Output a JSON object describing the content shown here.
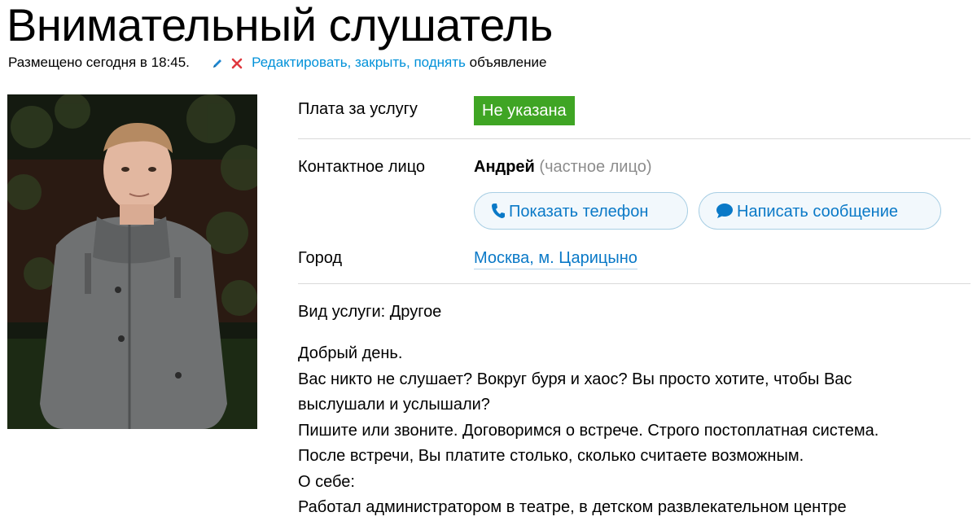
{
  "title": "Внимательный слушатель",
  "posted": {
    "text": "Размещено сегодня в 18:45.",
    "edit_link": "Редактировать, закрыть, поднять",
    "edit_suffix": "объявление"
  },
  "params": {
    "price_label": "Плата за услугу",
    "price_value": "Не указана",
    "contact_label": "Контактное лицо",
    "contact_name": "Андрей",
    "contact_type": "(частное лицо)",
    "show_phone_button": "Показать телефон",
    "write_message_button": "Написать сообщение",
    "city_label": "Город",
    "city_value": "Москва, м. Царицыно"
  },
  "service_type": "Вид услуги: Другое",
  "description": [
    "Добрый день.",
    "Вас никто не слушает? Вокруг буря и хаос? Вы просто хотите, чтобы Вас",
    "выслушали и услышали?",
    "Пишите или звоните. Договоримся о встрече. Строго постоплатная система.",
    "После встречи, Вы платите столько, сколько считаете возможным.",
    "О себе:",
    "Работал администратором в театре, в детском развлекательном центре"
  ],
  "colors": {
    "link": "#0a79c7",
    "price_badge": "#3fa524",
    "close_icon": "#e0383e",
    "muted": "#8c8c8c"
  },
  "icons": {
    "edit": "pencil-icon",
    "close": "close-icon",
    "phone": "phone-icon",
    "message": "chat-bubble-icon"
  }
}
